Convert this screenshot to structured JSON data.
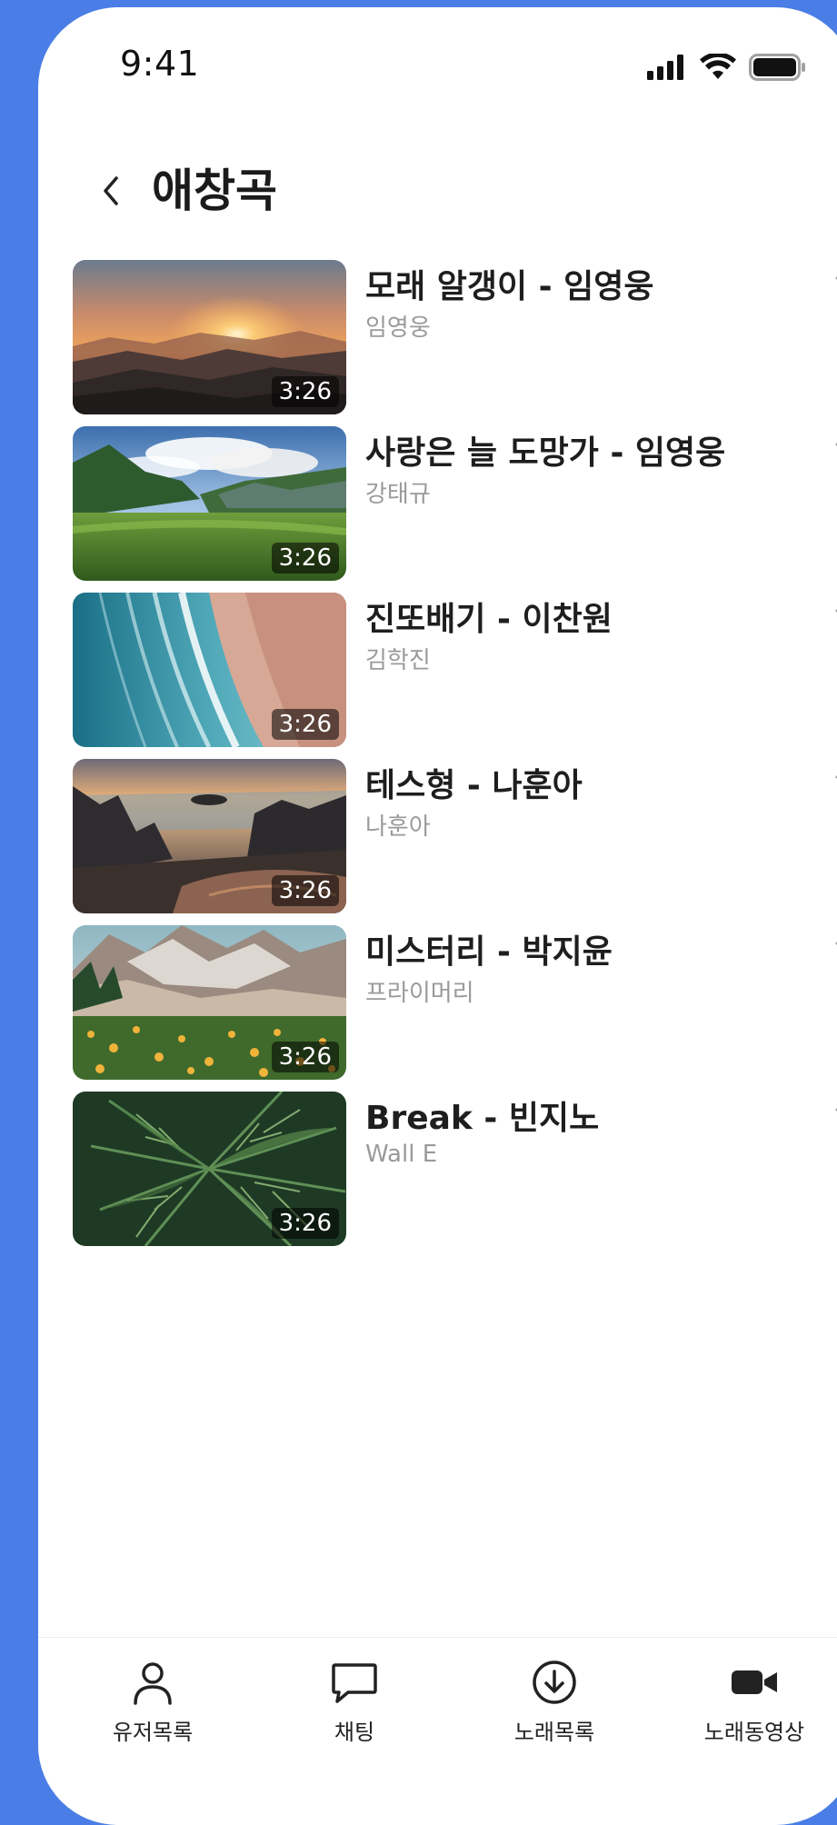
{
  "status_bar": {
    "time": "9:41"
  },
  "header": {
    "title": "애창곡"
  },
  "songs": [
    {
      "title": "모래 알갱이 - 임영웅",
      "artist": "임영웅",
      "duration": "3:26",
      "thumb": "sunset-mountains"
    },
    {
      "title": "사랑은 늘 도망가 - 임영웅",
      "artist": "강태규",
      "duration": "3:26",
      "thumb": "green-valley"
    },
    {
      "title": "진또배기 - 이찬원",
      "artist": "김학진",
      "duration": "3:26",
      "thumb": "beach-waves"
    },
    {
      "title": "테스형 - 나훈아",
      "artist": "나훈아",
      "duration": "3:26",
      "thumb": "lake-forest"
    },
    {
      "title": "미스터리 - 박지윤",
      "artist": "프라이머리",
      "duration": "3:26",
      "thumb": "alpine-meadow"
    },
    {
      "title": "Break - 빈지노",
      "artist": "Wall E",
      "duration": "3:26",
      "thumb": "palm-leaves"
    }
  ],
  "nav": {
    "items": [
      {
        "label": "유저목록",
        "icon": "user-icon"
      },
      {
        "label": "채팅",
        "icon": "chat-icon"
      },
      {
        "label": "노래목록",
        "icon": "download-circle-icon"
      },
      {
        "label": "노래동영상",
        "icon": "video-camera-icon"
      }
    ]
  },
  "colors": {
    "background": "#4a7ee6",
    "screen": "#ffffff",
    "title_text": "#1e1e1e",
    "subtitle_text": "#9a9a9a",
    "icon_gray": "#9a9a9a"
  }
}
